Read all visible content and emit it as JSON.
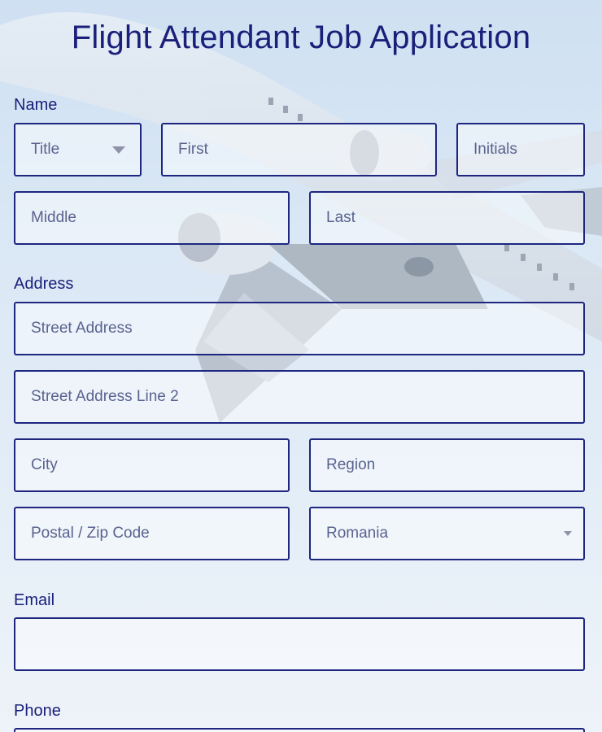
{
  "page": {
    "title": "Flight Attendant Job Application"
  },
  "name_section": {
    "label": "Name",
    "title_select": {
      "selected": "Title"
    },
    "first": {
      "placeholder": "First"
    },
    "initials": {
      "placeholder": "Initials"
    },
    "middle": {
      "placeholder": "Middle"
    },
    "last": {
      "placeholder": "Last"
    }
  },
  "address_section": {
    "label": "Address",
    "street": {
      "placeholder": "Street Address"
    },
    "street2": {
      "placeholder": "Street Address Line 2"
    },
    "city": {
      "placeholder": "City"
    },
    "region": {
      "placeholder": "Region"
    },
    "postal": {
      "placeholder": "Postal / Zip Code"
    },
    "country": {
      "selected": "Romania"
    }
  },
  "email_section": {
    "label": "Email",
    "value": ""
  },
  "phone_section": {
    "label": "Phone"
  },
  "theme": {
    "accent": "#1e2680",
    "title_color": "#1a1f7a"
  }
}
